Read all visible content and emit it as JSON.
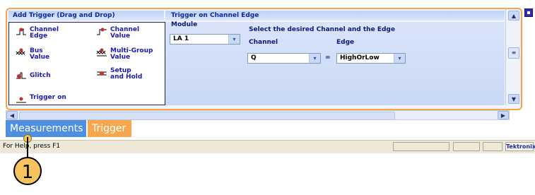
{
  "add_trigger": {
    "header": "Add Trigger (Drag and Drop)",
    "items": [
      {
        "label1": "Channel",
        "label2": "Edge",
        "icon": "channel-edge-icon"
      },
      {
        "label1": "Channel",
        "label2": "Value",
        "icon": "channel-value-icon"
      },
      {
        "label1": "Bus",
        "label2": "Value",
        "icon": "bus-value-icon"
      },
      {
        "label1": "Multi-Group",
        "label2": "Value",
        "icon": "multi-group-value-icon"
      },
      {
        "label1": "Glitch",
        "label2": "",
        "icon": "glitch-icon"
      },
      {
        "label1": "Setup",
        "label2": "and Hold",
        "icon": "setup-hold-icon"
      },
      {
        "label1": "Trigger on",
        "label2": "",
        "icon": "trigger-on-icon"
      }
    ]
  },
  "trigger": {
    "header": "Trigger on Channel Edge",
    "module_label": "Module",
    "module_value": "LA 1",
    "instruction": "Select the desired Channel and the Edge",
    "channel_label": "Channel",
    "channel_value": "Q",
    "equals": "=",
    "edge_label": "Edge",
    "edge_value": "HighOrLow"
  },
  "tabs": [
    {
      "label": "Measurements",
      "color": "#4f8fe0"
    },
    {
      "label": "Trigger",
      "color": "#f6a64c"
    }
  ],
  "status": {
    "help_text": "For Help, press F1",
    "brand": "Tektronix"
  },
  "callout": {
    "number": "1"
  },
  "colors": {
    "accent_orange": "#f7a44a",
    "header_blue": "#0a2a9c"
  }
}
